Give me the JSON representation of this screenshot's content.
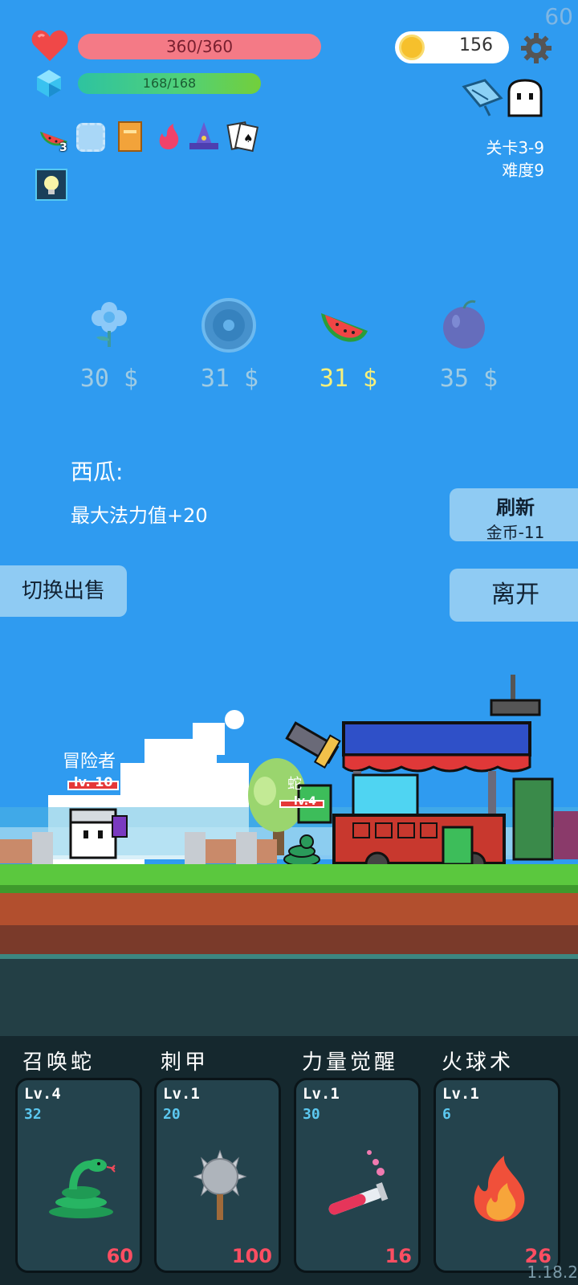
{
  "fps": "60",
  "hud": {
    "hp": "360/360",
    "mp": "168/168",
    "coins": "156",
    "stage": "关卡3-9",
    "difficulty": "难度9",
    "watermelon_count": "3",
    "icons": [
      "heart-icon",
      "gem-icon",
      "coin-icon",
      "gear-icon",
      "map-icon",
      "ghost-icon"
    ],
    "inventory": [
      "watermelon-icon",
      "empty-slot-icon",
      "book-icon",
      "flame-icon",
      "wizard-hat-icon",
      "cards-icon",
      "lightbulb-icon"
    ]
  },
  "shop": {
    "items": [
      {
        "icon": "flower-icon",
        "price": "30 $",
        "selected": false
      },
      {
        "icon": "shield-icon",
        "price": "31 $",
        "selected": false
      },
      {
        "icon": "watermelon-icon",
        "price": "31 $",
        "selected": true
      },
      {
        "icon": "plum-icon",
        "price": "35 $",
        "selected": false
      }
    ],
    "selected_title": "西瓜:",
    "selected_desc": "最大法力值+20",
    "refresh_label": "刷新",
    "refresh_cost": "金币-11",
    "leave_label": "离开",
    "switch_label": "切换出售"
  },
  "scene": {
    "hero_name": "冒险者",
    "hero_level": "lv. 10",
    "snake_name": "蛇",
    "snake_level": "lv.4"
  },
  "skills": [
    {
      "name": "召唤蛇",
      "level": "Lv.4",
      "value": "32",
      "cost": "60",
      "icon": "snake-icon"
    },
    {
      "name": "刺甲",
      "level": "Lv.1",
      "value": "20",
      "cost": "100",
      "icon": "spiked-mace-icon"
    },
    {
      "name": "力量觉醒",
      "level": "Lv.1",
      "value": "30",
      "cost": "16",
      "icon": "potion-tube-icon"
    },
    {
      "name": "火球术",
      "level": "Lv.1",
      "value": "6",
      "cost": "26",
      "icon": "fire-icon"
    }
  ],
  "version": "1.18.2",
  "colors": {
    "hp": "#f47a86",
    "mp_start": "#2ec3a0",
    "mp_end": "#73cf3b",
    "sky": "#2f9bf0",
    "price_selected": "#f8f07a",
    "cost": "#ff4e62"
  }
}
